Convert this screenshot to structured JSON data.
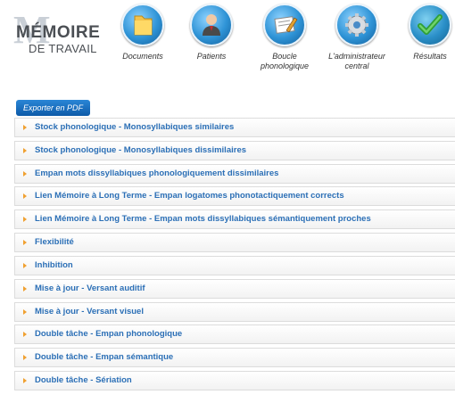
{
  "logo": {
    "line1": "MÉMOIRE",
    "line2": "DE TRAVAIL",
    "letter": "M"
  },
  "nav": [
    {
      "label": "Documents",
      "icon": "folder-icon"
    },
    {
      "label": "Patients",
      "icon": "user-icon"
    },
    {
      "label": "Boucle phonologique",
      "icon": "note-pencil-icon"
    },
    {
      "label": "L'administrateur central",
      "icon": "gear-icon"
    },
    {
      "label": "Résultats",
      "icon": "checkmark-icon"
    }
  ],
  "export_button": "Exporter en PDF",
  "sections": [
    "Stock phonologique - Monosyllabiques similaires",
    "Stock phonologique - Monosyllabiques dissimilaires",
    "Empan mots dissyllabiques phonologiquement dissimilaires",
    "Lien Mémoire à Long Terme - Empan logatomes phonotactiquement corrects",
    "Lien Mémoire à Long Terme - Empan mots dissyllabiques sémantiquement proches",
    "Flexibilité",
    "Inhibition",
    "Mise à jour - Versant auditif",
    "Mise à jour - Versant visuel",
    "Double tâche - Empan phonologique",
    "Double tâche - Empan sémantique",
    "Double tâche - Sériation"
  ],
  "colors": {
    "accent": "#2b6fb6",
    "arrow": "#f0a030",
    "button": "#0d5aa8"
  }
}
